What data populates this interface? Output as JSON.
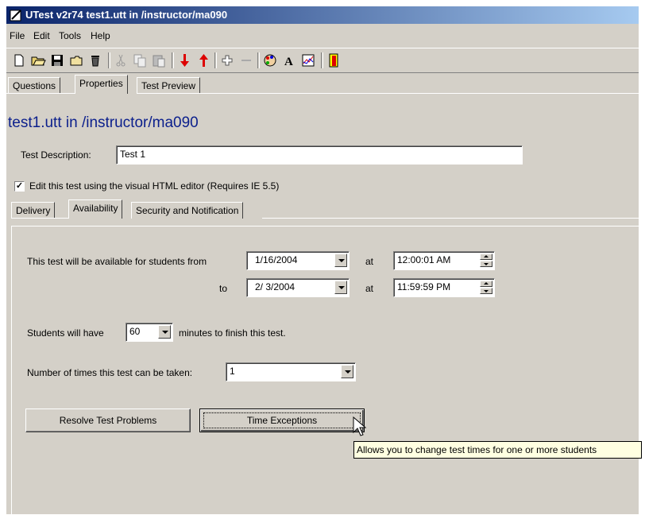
{
  "window": {
    "title": "UTest v2r74 test1.utt in /instructor/ma090"
  },
  "menu": [
    {
      "label": "File"
    },
    {
      "label": "Edit"
    },
    {
      "label": "Tools"
    },
    {
      "label": "Help"
    }
  ],
  "toolbar": {
    "icons": [
      "new-icon",
      "open-icon",
      "save-icon",
      "folder-icon",
      "delete-icon",
      "cut-icon",
      "copy-icon",
      "paste-icon",
      "move-down-icon",
      "move-up-icon",
      "add-icon",
      "remove-icon",
      "palette-icon",
      "font-icon",
      "chart-icon",
      "exit-icon"
    ]
  },
  "tabs": {
    "questions": "Questions",
    "properties": "Properties",
    "preview": "Test Preview"
  },
  "heading": "test1.utt in /instructor/ma090",
  "description": {
    "label": "Test Description:",
    "value": "Test 1"
  },
  "html_editor": {
    "label": "Edit this test using the visual HTML editor (Requires IE 5.5)",
    "checked": true
  },
  "subtabs": {
    "delivery": "Delivery",
    "availability": "Availability",
    "security": "Security and Notification"
  },
  "availability": {
    "from_label": "This test will be available for students from",
    "to_label": "to",
    "at_label": "at",
    "from_date": "1/16/2004",
    "from_time": "12:00:01 AM",
    "to_date": "2/ 3/2004",
    "to_time": "11:59:59 PM"
  },
  "duration": {
    "prefix": "Students will have",
    "value": "60",
    "suffix": "minutes to finish this test."
  },
  "attempts": {
    "label": "Number of times this test can be taken:",
    "value": "1"
  },
  "buttons": {
    "resolve": "Resolve Test Problems",
    "exceptions": "Time Exceptions"
  },
  "tooltip": "Allows you to change test times for one or more students"
}
